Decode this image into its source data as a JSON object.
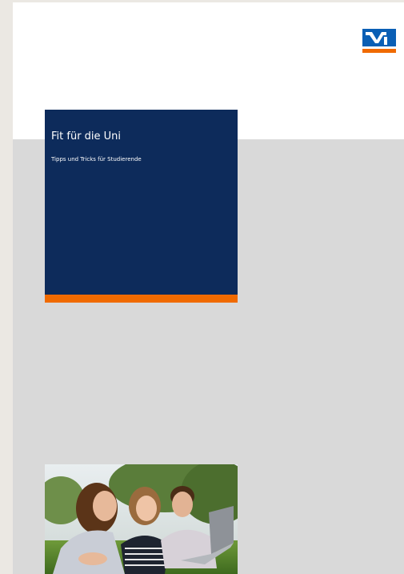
{
  "brochure": {
    "title": "Fit für die Uni",
    "subtitle": "Tipps und Tricks für Studierende"
  },
  "logo": {
    "icon": "volksbank-raiffeisenbank-logo",
    "colors": {
      "blue": "#0a5fb5",
      "orange": "#f06a00"
    }
  },
  "photo": {
    "subject": "students-lying-on-grass-with-laptop"
  },
  "colors": {
    "title_box": "#0d2b5b",
    "accent": "#f06a00",
    "page_background": "#d9d9d9",
    "header_background": "#ffffff"
  }
}
